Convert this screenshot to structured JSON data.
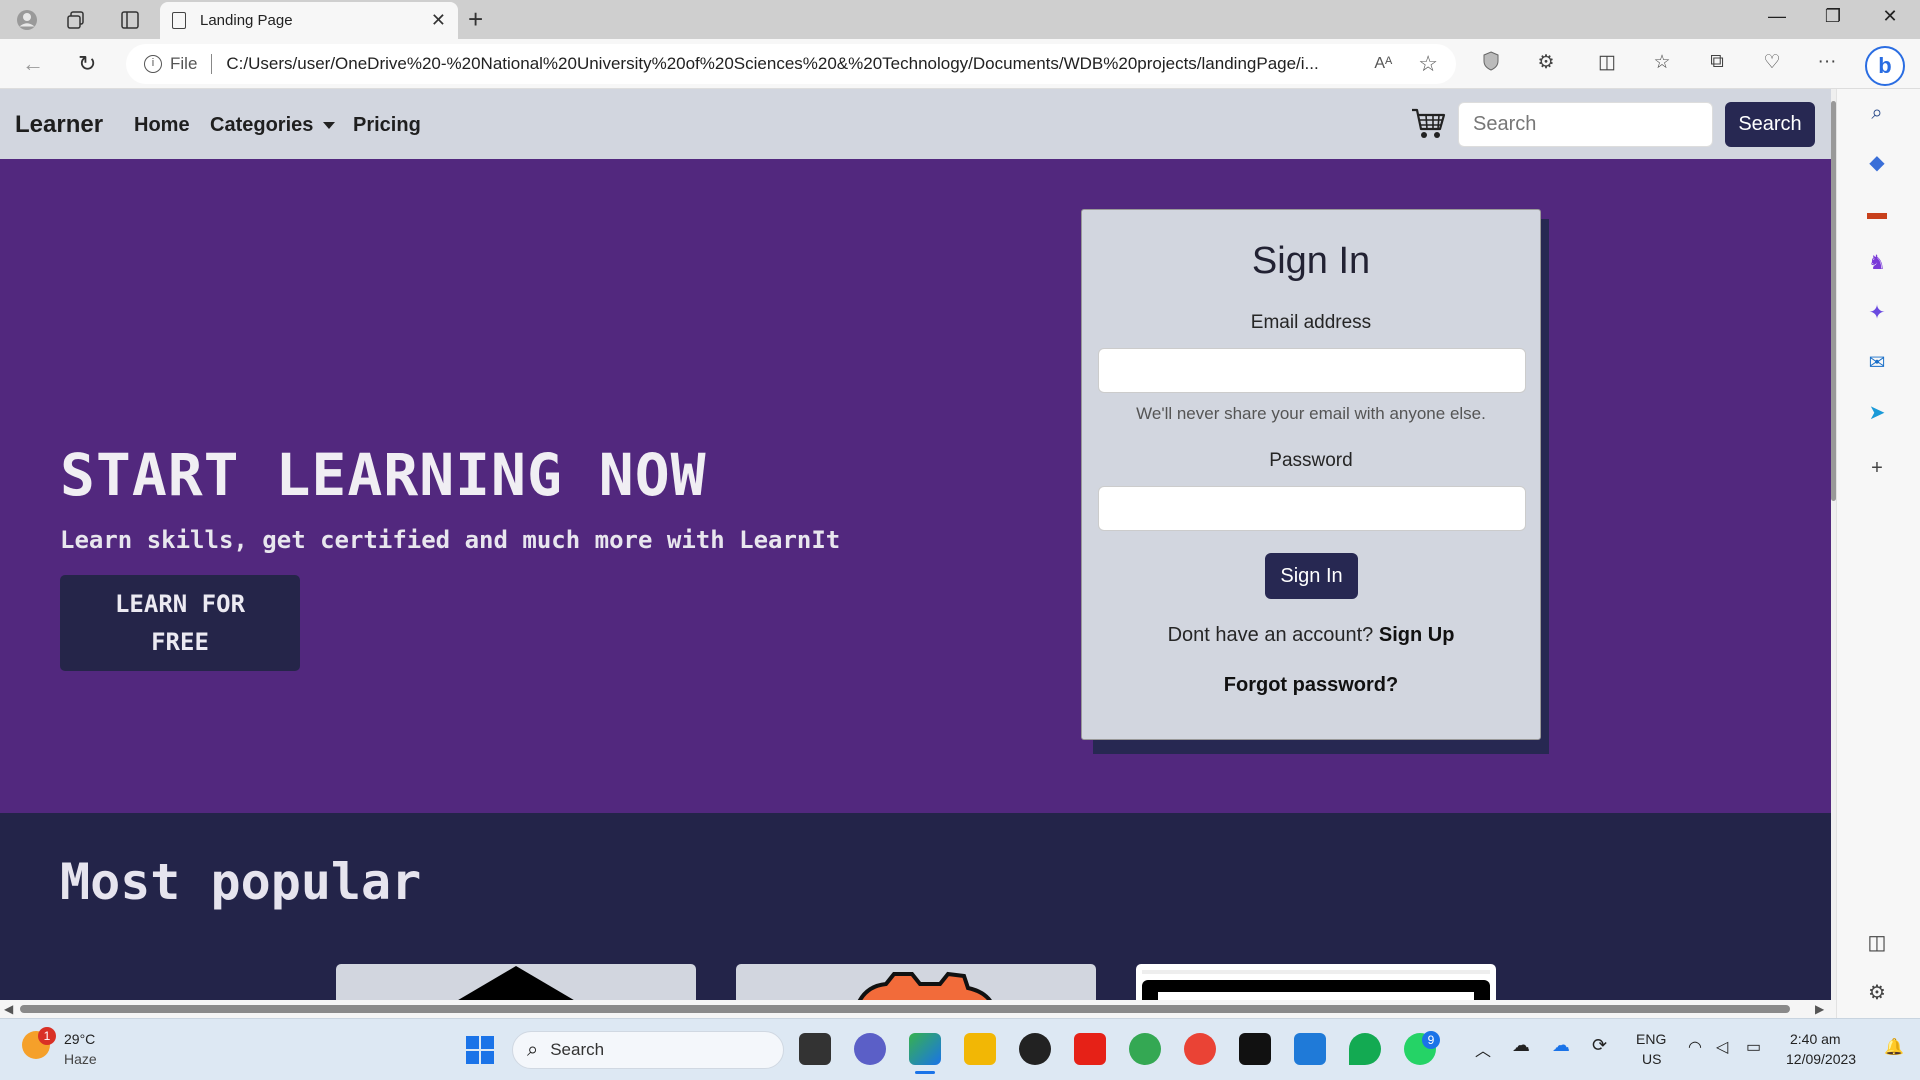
{
  "browser": {
    "tab_title": "Landing Page",
    "address_prefix": "File",
    "url": "C:/Users/user/OneDrive%20-%20National%20University%20of%20Sciences%20&%20Technology/Documents/WDB%20projects/landingPage/i...",
    "read_aloud": "Aᴬ"
  },
  "site_nav": {
    "brand": "Learner",
    "links": [
      "Home",
      "Categories",
      "Pricing"
    ],
    "search_placeholder": "Search",
    "search_button": "Search"
  },
  "hero": {
    "title": "START LEARNING NOW",
    "subtitle": "Learn skills, get certified and much more with LearnIt",
    "cta_line1": "LEARN FOR",
    "cta_line2": "FREE"
  },
  "signin": {
    "title": "Sign In",
    "email_label": "Email address",
    "email_help": "We'll never share your email with anyone else.",
    "password_label": "Password",
    "submit": "Sign In",
    "no_account": "Dont have an account?",
    "signup_link": "Sign Up",
    "forgot": "Forgot password?"
  },
  "popular": {
    "title": "Most popular"
  },
  "taskbar": {
    "weather_temp": "29°C",
    "weather_desc": "Haze",
    "weather_badge": "1",
    "search_label": "Search",
    "lang": "ENG",
    "region": "US",
    "time": "2:40 am",
    "date": "12/09/2023",
    "whatsapp_badge": "9"
  },
  "colors": {
    "hero_bg": "#52287e",
    "navy": "#272852",
    "nav_bg": "#d2d6df",
    "popular_bg": "#232449"
  }
}
